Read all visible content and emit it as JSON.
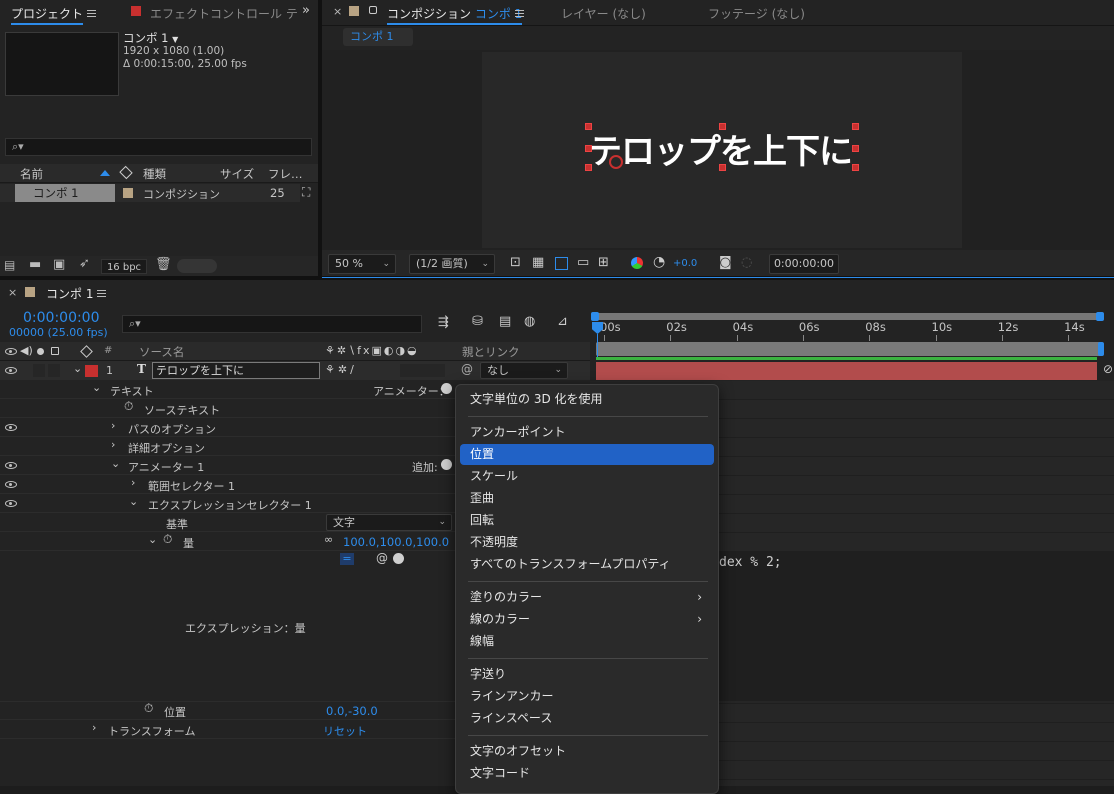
{
  "project_panel": {
    "tab_label": "プロジェクト",
    "effects_tab_label": "エフェクトコントロール テ",
    "comp_name": "コンポ 1",
    "comp_resolution": "1920 x 1080 (1.00)",
    "comp_duration": "Δ 0:00:15:00, 25.00 fps",
    "search_placeholder": "",
    "columns": {
      "name": "名前",
      "type": "種類",
      "size": "サイズ",
      "frame": "フレ…"
    },
    "items": [
      {
        "name": "コンポ 1",
        "type": "コンポジション",
        "frame": "25"
      }
    ],
    "bpc": "16 bpc"
  },
  "composition_panel": {
    "tab_label": "コンポジション",
    "tab_comp_name": "コンポ 1",
    "layer_tab": "レイヤー (なし)",
    "footage_tab": "フッテージ (なし)",
    "breadcrumb": "コンポ 1",
    "canvas_text": "テロップを上下に",
    "zoom": "50 %",
    "resolution": "(1/2 画質)",
    "exposure": "+0.0",
    "timecode": "0:00:00:00"
  },
  "timeline": {
    "tab_label": "コンポ 1",
    "current_time": "0:00:00:00",
    "current_frame": "00000 (25.00 fps)",
    "columns": {
      "num": "#",
      "source_name": "ソース名",
      "parent": "親とリンク"
    },
    "layer": {
      "number": "1",
      "name": "テロップを上下に",
      "parent": "なし"
    },
    "properties": {
      "text": "テキスト",
      "animator_label": "アニメーター：",
      "source_text": "ソーステキスト",
      "path_options": "パスのオプション",
      "more_options": "詳細オプション",
      "animator1": "アニメーター 1",
      "add_label": "追加:",
      "range_selector": "範囲セレクター 1",
      "expression_selector": "エクスプレッションセレクター 1",
      "based_on_label": "基準",
      "based_on_value": "文字",
      "amount_label": "量",
      "amount_value": "100.0,100.0,100.0",
      "expression_label": "エクスプレッション：量",
      "expression_code": "dex % 2;",
      "position_label": "位置",
      "position_value": "0.0,-30.0",
      "transform": "トランスフォーム",
      "reset": "リセット"
    },
    "ruler_ticks": [
      "00s",
      "02s",
      "04s",
      "06s",
      "08s",
      "10s",
      "12s",
      "14s"
    ]
  },
  "context_menu": {
    "items": [
      "文字単位の 3D 化を使用",
      "アンカーポイント",
      "位置",
      "スケール",
      "歪曲",
      "回転",
      "不透明度",
      "すべてのトランスフォームプロパティ",
      "塗りのカラー",
      "線のカラー",
      "線幅",
      "字送り",
      "ラインアンカー",
      "ラインスペース",
      "文字のオフセット",
      "文字コード"
    ],
    "selected": "位置",
    "submenu_arrow": "›"
  },
  "colors": {
    "accent": "#2d8ceb",
    "layer_label": "#c8302f",
    "menu_highlight": "#2162c6",
    "green_bar": "#3cb341"
  }
}
